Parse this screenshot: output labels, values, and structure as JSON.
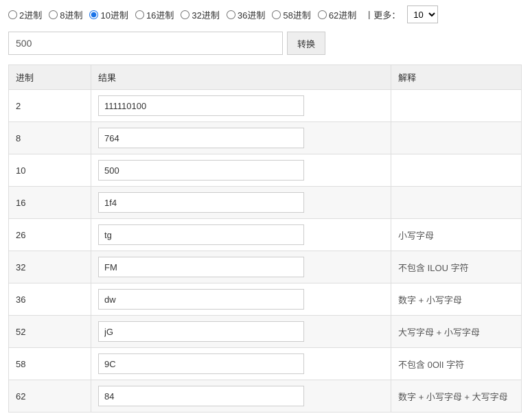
{
  "radios": [
    {
      "label": "2进制",
      "checked": false
    },
    {
      "label": "8进制",
      "checked": false
    },
    {
      "label": "10进制",
      "checked": true
    },
    {
      "label": "16进制",
      "checked": false
    },
    {
      "label": "32进制",
      "checked": false
    },
    {
      "label": "36进制",
      "checked": false
    },
    {
      "label": "58进制",
      "checked": false
    },
    {
      "label": "62进制",
      "checked": false
    }
  ],
  "more_label": "丨更多：",
  "more_select_value": "10",
  "input_value": "500",
  "convert_label": "转换",
  "table": {
    "headers": {
      "base": "进制",
      "result": "结果",
      "desc": "解释"
    },
    "rows": [
      {
        "base": "2",
        "result": "111110100",
        "desc": ""
      },
      {
        "base": "8",
        "result": "764",
        "desc": ""
      },
      {
        "base": "10",
        "result": "500",
        "desc": ""
      },
      {
        "base": "16",
        "result": "1f4",
        "desc": ""
      },
      {
        "base": "26",
        "result": "tg",
        "desc": "小写字母"
      },
      {
        "base": "32",
        "result": "FM",
        "desc": "不包含 ILOU 字符"
      },
      {
        "base": "36",
        "result": "dw",
        "desc": "数字 + 小写字母"
      },
      {
        "base": "52",
        "result": "jG",
        "desc": "大写字母 + 小写字母"
      },
      {
        "base": "58",
        "result": "9C",
        "desc": "不包含 0OlI 字符"
      },
      {
        "base": "62",
        "result": "84",
        "desc": "数字 + 小写字母 + 大写字母"
      }
    ]
  }
}
